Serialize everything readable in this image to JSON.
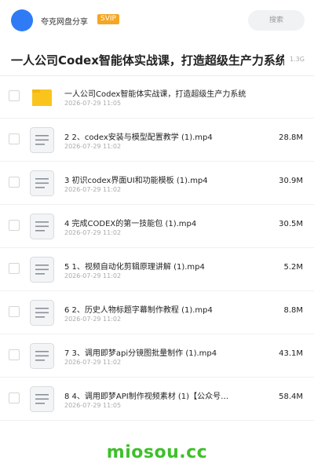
{
  "header": {
    "share_title": "夸克网盘分享",
    "badge": "SVIP",
    "search_placeholder": "搜索"
  },
  "folder": {
    "title": "一人公司Codex智能体实战课，打造超级生产力系统",
    "size": "1.3G"
  },
  "files": [
    {
      "type": "folder",
      "name": "一人公司Codex智能体实战课，打造超级生产力系统",
      "date": "2026-07-29 11:05",
      "size": ""
    },
    {
      "type": "video",
      "name": "2 2、codex安装与模型配置教学 (1).mp4",
      "date": "2026-07-29 11:02",
      "size": "28.8M"
    },
    {
      "type": "video",
      "name": "3 初识codex界面UI和功能模板 (1).mp4",
      "date": "2026-07-29 11:02",
      "size": "30.9M"
    },
    {
      "type": "video",
      "name": "4 完成CODEX的第一技能包 (1).mp4",
      "date": "2026-07-29 11:02",
      "size": "30.5M"
    },
    {
      "type": "video",
      "name": "5 1、视频自动化剪辑原理讲解 (1).mp4",
      "date": "2026-07-29 11:02",
      "size": "5.2M"
    },
    {
      "type": "video",
      "name": "6 2、历史人物标题字幕制作教程 (1).mp4",
      "date": "2026-07-29 11:02",
      "size": "8.8M"
    },
    {
      "type": "video",
      "name": "7 3、调用即梦api分镜图批量制作 (1).mp4",
      "date": "2026-07-29 11:02",
      "size": "43.1M"
    },
    {
      "type": "video",
      "name": "8 4、调用即梦API制作视频素材 (1)【公众号…",
      "date": "2026-07-29 11:05",
      "size": "58.4M"
    }
  ],
  "watermark": "miosou.cc",
  "colors": {
    "accent": "#2f7bf6",
    "svip": "#f5a623",
    "folder": "#f9c51d",
    "watermark": "#3fbf2c"
  }
}
